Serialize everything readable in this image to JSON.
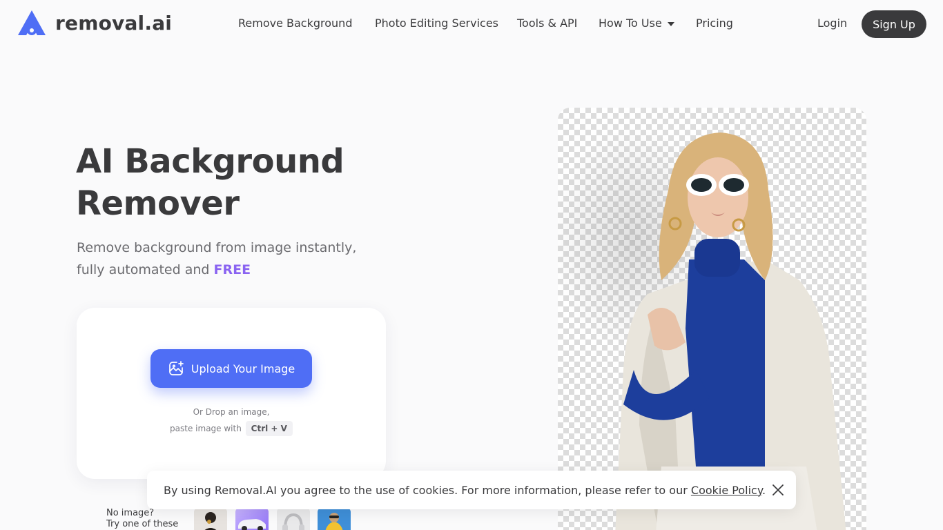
{
  "brand": {
    "name": "removal.ai",
    "accent": "#4f6ef5"
  },
  "nav": {
    "items": [
      {
        "label": "Remove Background"
      },
      {
        "label": "Photo Editing Services"
      },
      {
        "label": "Tools & API"
      },
      {
        "label": "How To Use",
        "has_dropdown": true
      },
      {
        "label": "Pricing"
      }
    ],
    "login_label": "Login",
    "signup_label": "Sign Up"
  },
  "hero": {
    "title_line1": "AI Background",
    "title_line2": "Remover",
    "subtitle_line1": "Remove background from image instantly,",
    "subtitle_line2_prefix": "fully automated and ",
    "subtitle_highlight": "FREE",
    "highlight_color": "#8a63f1"
  },
  "upload": {
    "button_label": "Upload Your Image",
    "drop_line1": "Or Drop an image,",
    "drop_line2": "paste image with",
    "shortcut": "Ctrl + V"
  },
  "samples": {
    "label_line1": "No image?",
    "label_line2": "Try one of these",
    "items": [
      {
        "icon": "person-thumbnail"
      },
      {
        "icon": "car-thumbnail"
      },
      {
        "icon": "headphones-thumbnail"
      },
      {
        "icon": "dog-thumbnail"
      }
    ]
  },
  "cookie": {
    "text": "By using Removal.AI you agree to the use of cookies. For more information, please refer to our ",
    "link_label": "Cookie Policy",
    "suffix": "."
  }
}
